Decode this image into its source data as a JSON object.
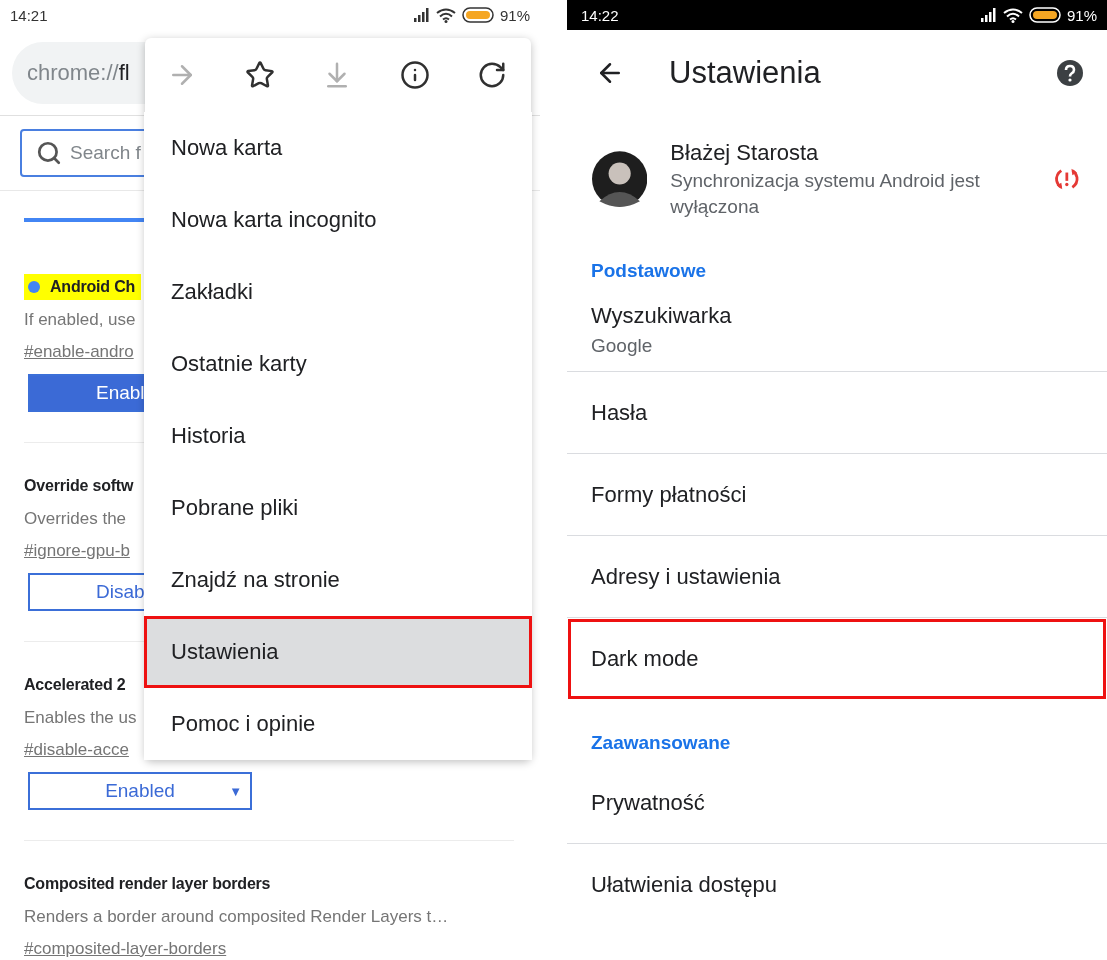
{
  "left_phone": {
    "status_bar": {
      "time": "14:21",
      "battery": "91%"
    },
    "url": {
      "scheme": "chrome://",
      "host": "fl"
    },
    "search": {
      "placeholder": "Search f"
    },
    "flags": [
      {
        "title": "Android Ch",
        "highlighted": true,
        "description": "If enabled, use",
        "link": "#enable-andro",
        "control": {
          "kind": "filled",
          "value": "Enabl"
        }
      },
      {
        "title": "Override softw",
        "highlighted": false,
        "description": "Overrides the",
        "link": "#ignore-gpu-b",
        "control": {
          "kind": "outline",
          "value": "Disab"
        }
      },
      {
        "title": "Accelerated 2",
        "highlighted": false,
        "description": "Enables the us",
        "link": "#disable-acce",
        "control": {
          "kind": "dropdown",
          "value": "Enabled",
          "arrow": "▼"
        }
      },
      {
        "title": "Composited render layer borders",
        "highlighted": false,
        "description": "Renders a border around composited Render Layers t…",
        "link": "#composited-layer-borders"
      }
    ]
  },
  "menu": {
    "toolbar": [
      {
        "kind": "forward",
        "disabled": true
      },
      {
        "kind": "bookmark",
        "disabled": false
      },
      {
        "kind": "download",
        "disabled": true
      },
      {
        "kind": "info",
        "disabled": false
      },
      {
        "kind": "refresh",
        "disabled": false
      }
    ],
    "items": [
      {
        "label": "Nowa karta",
        "selected": false
      },
      {
        "label": "Nowa karta incognito",
        "selected": false
      },
      {
        "label": "Zakładki",
        "selected": false
      },
      {
        "label": "Ostatnie karty",
        "selected": false
      },
      {
        "label": "Historia",
        "selected": false
      },
      {
        "label": "Pobrane pliki",
        "selected": false
      },
      {
        "label": "Znajdź na stronie",
        "selected": false
      },
      {
        "label": "Ustawienia",
        "selected": true
      },
      {
        "label": "Pomoc i opinie",
        "selected": false
      }
    ]
  },
  "right_phone": {
    "status_bar": {
      "time": "14:22",
      "battery": "91%"
    },
    "title": "Ustawienia",
    "profile": {
      "name": "Błażej Starosta",
      "status": "Synchronizacja systemu Android jest wyłączona"
    },
    "entries": [
      {
        "kind": "heading",
        "label": "Podstawowe"
      },
      {
        "kind": "row",
        "label": "Wyszukiwarka",
        "sublabel": "Google",
        "highlighted": false
      },
      {
        "kind": "row",
        "label": "Hasła",
        "highlighted": false
      },
      {
        "kind": "row",
        "label": "Formy płatności",
        "highlighted": false
      },
      {
        "kind": "row",
        "label": "Adresy i ustawienia",
        "highlighted": false
      },
      {
        "kind": "row",
        "label": "Dark mode",
        "highlighted": true
      },
      {
        "kind": "heading",
        "label": "Zaawansowane"
      },
      {
        "kind": "row",
        "label": "Prywatność",
        "highlighted": false
      },
      {
        "kind": "row",
        "label": "Ułatwienia dostępu",
        "highlighted": false
      }
    ]
  }
}
